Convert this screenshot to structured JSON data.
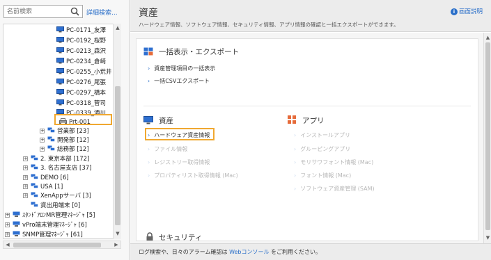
{
  "search": {
    "placeholder": "名前検索",
    "advanced_link": "詳細検索..."
  },
  "tree": {
    "pcs": [
      "PC-0171_友澤",
      "PC-0192_桜野",
      "PC-0213_森沢",
      "PC-0234_倉崎",
      "PC-0255_小荒井",
      "PC-0276_尾張",
      "PC-0297_橋本",
      "PC-0318_菅司",
      "PC-0339_酒川"
    ],
    "printer": "Prt-001",
    "departments": [
      "営業部 [23]",
      "開発部 [12]",
      "総務部 [12]"
    ],
    "branches": [
      "2. 東京本部 [172]",
      "3. 名古屋支店 [37]"
    ],
    "groups": [
      "DEMO [6]",
      "USA [1]",
      "XenAppサーバ [3]",
      "貸出用端末 [0]"
    ],
    "roots": [
      "ｽﾀﾝﾄﾞｱﾛﾝMR管理ﾏﾈｰｼﾞｬ [5]",
      "vPro端末管理ﾏﾈｰｼﾞｬ [6]",
      "SNMP管理ﾏﾈｰｼﾞｬ [61]"
    ]
  },
  "header": {
    "title": "資産",
    "description": "ハードウェア情報、ソフトウェア情報、セキュリティ情報、アプリ情報の確認と一括エクスポートができます。",
    "help": "画面説明"
  },
  "sections": {
    "bulk": {
      "title": "一括表示・エクスポート",
      "links": [
        "資産管理項目の一括表示",
        "一括CSVエクスポート"
      ]
    },
    "assets": {
      "title": "資産",
      "links": [
        "ハードウェア資産情報",
        "ファイル情報",
        "レジストリー取得情報",
        "プロパティリスト取得情報 (Mac)"
      ]
    },
    "apps": {
      "title": "アプリ",
      "links": [
        "インストールアプリ",
        "グルーピングアプリ",
        "モリサワフォント情報 (Mac)",
        "フォント情報 (Mac)",
        "ソフトウェア資産管理 (SAM)"
      ]
    },
    "security": {
      "title": "セキュリティ"
    }
  },
  "footer": {
    "prefix": "ログ検索や、日々のアラーム確認は ",
    "link": "Webコンソール",
    "suffix": " をご利用ください。"
  },
  "colors": {
    "accent": "#2a6fc9",
    "highlight": "#f0a830"
  }
}
